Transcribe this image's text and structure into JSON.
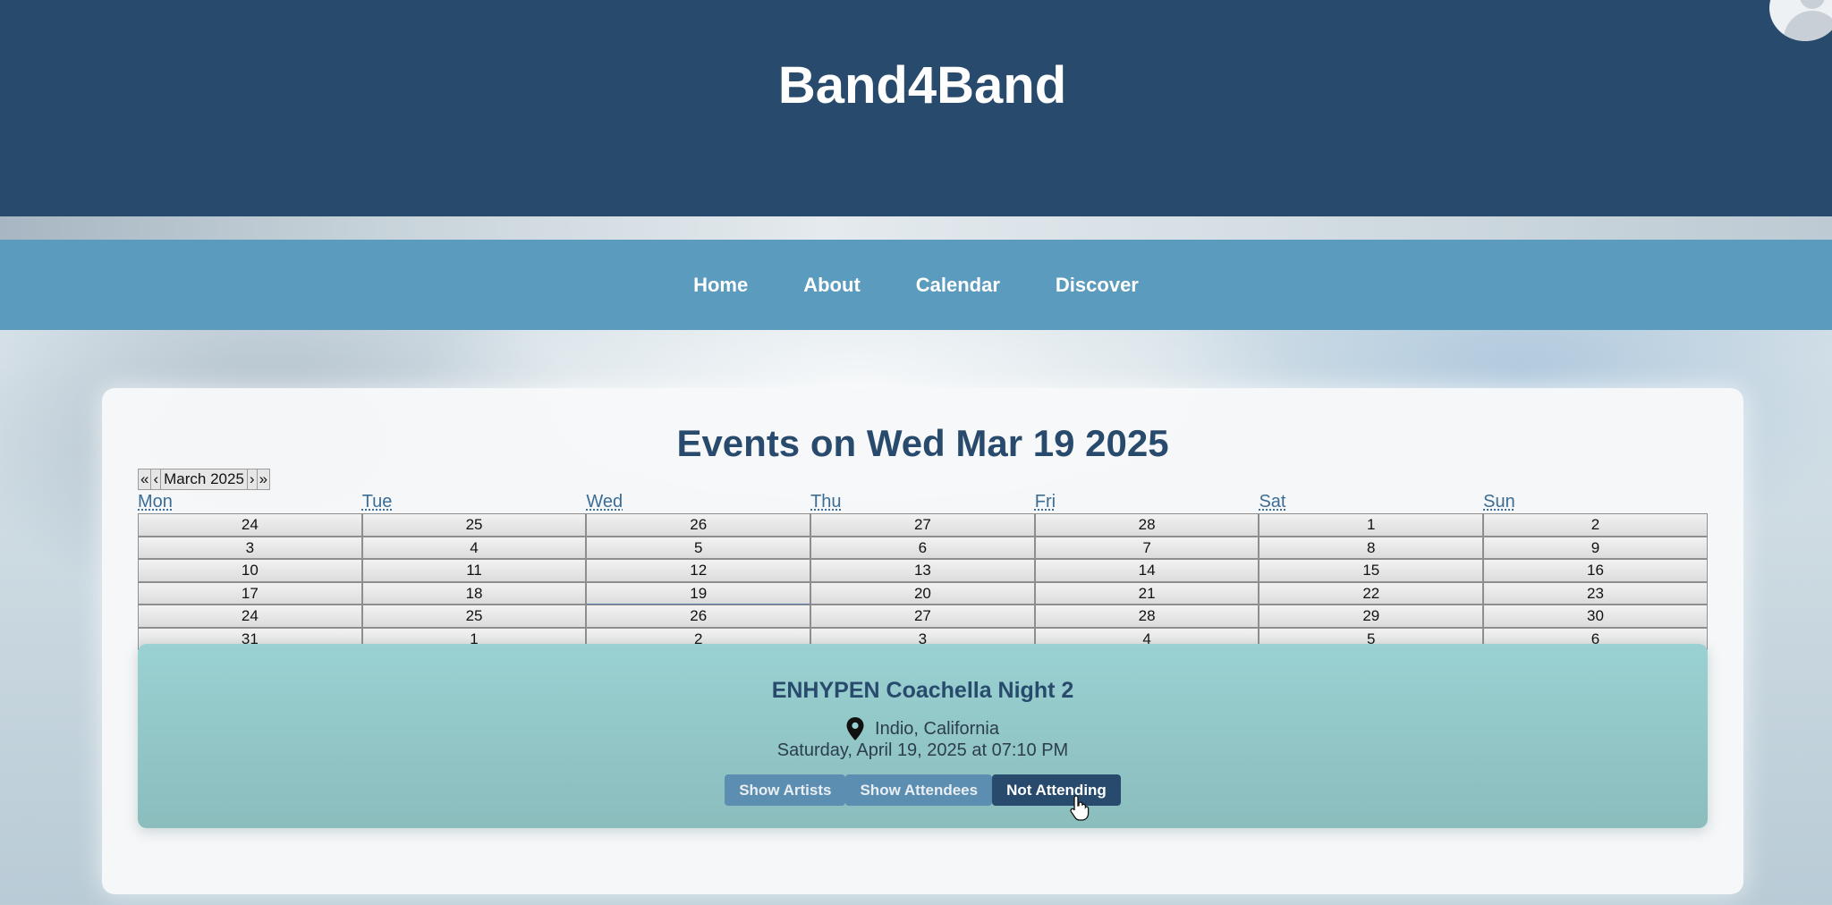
{
  "header": {
    "title": "Band4Band"
  },
  "nav": {
    "items": [
      "Home",
      "About",
      "Calendar",
      "Discover"
    ]
  },
  "events": {
    "title": "Events on Wed Mar 19 2025"
  },
  "calendar": {
    "nav": {
      "first": "«",
      "prev": "‹",
      "month_label": "March 2025",
      "next": "›",
      "last": "»"
    },
    "weekdays": [
      "Mon",
      "Tue",
      "Wed",
      "Thu",
      "Fri",
      "Sat",
      "Sun"
    ],
    "weeks": [
      [
        "24",
        "25",
        "26",
        "27",
        "28",
        "1",
        "2"
      ],
      [
        "3",
        "4",
        "5",
        "6",
        "7",
        "8",
        "9"
      ],
      [
        "10",
        "11",
        "12",
        "13",
        "14",
        "15",
        "16"
      ],
      [
        "17",
        "18",
        "19",
        "20",
        "21",
        "22",
        "23"
      ],
      [
        "24",
        "25",
        "26",
        "27",
        "28",
        "29",
        "30"
      ],
      [
        "31",
        "1",
        "2",
        "3",
        "4",
        "5",
        "6"
      ]
    ],
    "selected_day": "19"
  },
  "event": {
    "name": "ENHYPEN Coachella Night 2",
    "location": "Indio, California",
    "datetime": "Saturday, April 19, 2025 at 07:10 PM",
    "buttons": {
      "artists": "Show Artists",
      "attendees": "Show Attendees",
      "attendance": "Not Attending"
    }
  },
  "icons": {
    "location": "map-pin-icon",
    "avatar": "user-avatar-icon"
  },
  "colors": {
    "header_bg": "#284a6d",
    "nav_bg": "#5b9bbe",
    "event_card_bg": "#9ad1d2",
    "button_bg": "#5b8eb0",
    "button_active_bg": "#284a6d"
  }
}
